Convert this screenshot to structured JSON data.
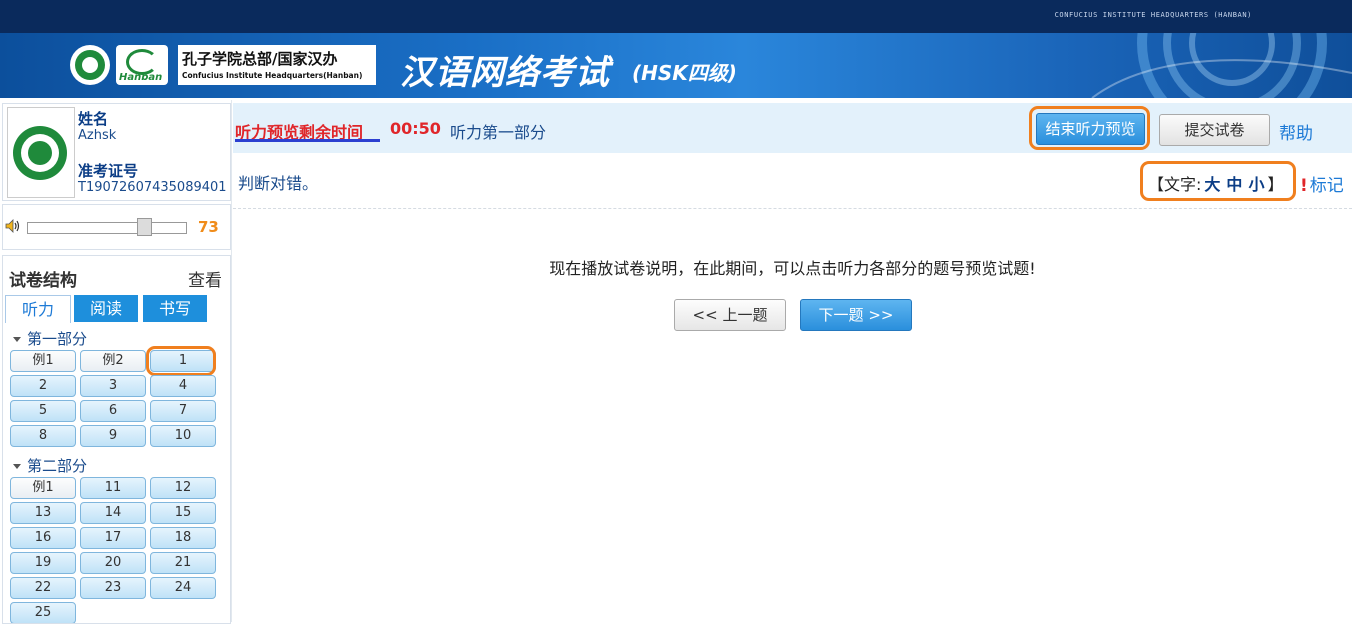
{
  "header": {
    "hq_text": "CONFUCIUS INSTITUTE HEADQUARTERS (HANBAN)",
    "hanban_logo_text": "Hanban",
    "org_cn": "孔子学院总部/国家汉办",
    "org_en": "Confucius Institute Headquarters(Hanban)",
    "title": "汉语网络考试",
    "subtitle": "(HSK四级)"
  },
  "candidate": {
    "name_label": "姓名",
    "name_value": "Azhsk",
    "id_label": "准考证号",
    "id_value": "T19072607435089401"
  },
  "volume": {
    "value": "73",
    "level": 0.73
  },
  "structure": {
    "title": "试卷结构",
    "view_label": "查看",
    "tabs": [
      "听力",
      "阅读",
      "书写"
    ],
    "active_tab": "听力",
    "sections": [
      {
        "label": "第一部分",
        "items": [
          "例1",
          "例2",
          "1",
          "2",
          "3",
          "4",
          "5",
          "6",
          "7",
          "8",
          "9",
          "10"
        ]
      },
      {
        "label": "第二部分",
        "items": [
          "例1",
          "11",
          "12",
          "13",
          "14",
          "15",
          "16",
          "17",
          "18",
          "19",
          "20",
          "21",
          "22",
          "23",
          "24",
          "25"
        ]
      }
    ]
  },
  "toolbar": {
    "time_label": "听力预览剩余时间",
    "timer": "00:50",
    "part_label": "听力第一部分",
    "end_preview_label": "结束听力预览",
    "submit_label": "提交试卷",
    "help_label": "帮助"
  },
  "question": {
    "instruction": "判断对错。",
    "font_prefix": "【文字:",
    "font_large": "大",
    "font_medium": "中",
    "font_small": "小",
    "font_suffix": "】",
    "mark_symbol": "!",
    "mark_label": "标记",
    "message": "现在播放试卷说明，在此期间，可以点击听力各部分的题号预览试题!",
    "prev_label": "<< 上一题",
    "next_label": "下一题 >>"
  },
  "colors": {
    "highlight": "#f07f1e",
    "timer_red": "#e0262a",
    "primary_blue": "#2a8fdc",
    "banner_dark": "#0a2a5c"
  }
}
